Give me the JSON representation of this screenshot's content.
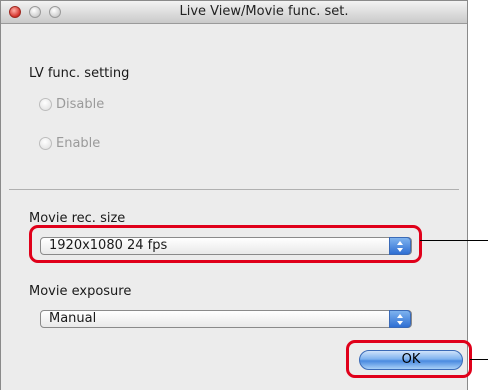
{
  "window": {
    "title": "Live View/Movie func. set."
  },
  "lv": {
    "label": "LV func. setting",
    "options": [
      {
        "label": "Disable"
      },
      {
        "label": "Enable"
      }
    ]
  },
  "movie_size": {
    "label": "Movie rec. size",
    "value": "1920x1080 24 fps"
  },
  "movie_exposure": {
    "label": "Movie exposure",
    "value": "Manual"
  },
  "buttons": {
    "ok": "OK"
  },
  "colors": {
    "highlight": "#e0001a",
    "accent": "#4a8ae0"
  }
}
